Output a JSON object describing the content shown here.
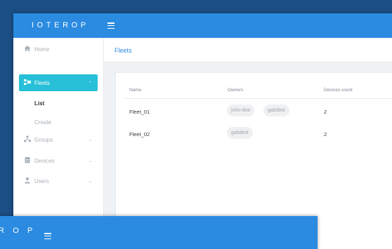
{
  "app": {
    "logo": "IOTEROP",
    "logo_partial": "R O P"
  },
  "sidebar": {
    "items": [
      {
        "label": "Home",
        "icon": "home-icon"
      },
      {
        "label": "Fleets",
        "icon": "fleet-icon",
        "active": true
      },
      {
        "label": "Groups",
        "icon": "groups-icon"
      },
      {
        "label": "Devices",
        "icon": "devices-icon"
      },
      {
        "label": "Users",
        "icon": "user-icon"
      }
    ],
    "sub_items": [
      {
        "label": "List",
        "active": true
      },
      {
        "label": "Create"
      }
    ]
  },
  "header": {
    "title": "Fleets"
  },
  "table": {
    "columns": [
      "Name",
      "Owners",
      "Devices count"
    ],
    "rows": [
      {
        "name": "Fleet_01",
        "owners": [
          "john-doe",
          "gabitbol"
        ],
        "devices": "2"
      },
      {
        "name": "Fleet_02",
        "owners": [
          "gabitbol"
        ],
        "devices": "2"
      }
    ]
  },
  "colors": {
    "topbar": "#2a8be0",
    "active_nav": "#27c0d8",
    "background": "#1b4f86"
  }
}
